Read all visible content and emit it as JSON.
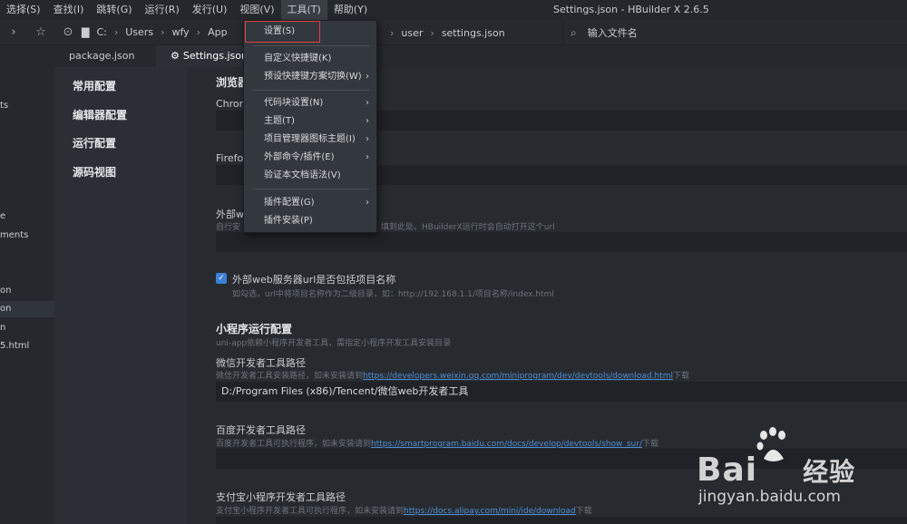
{
  "menubar": {
    "items": [
      "选择(S)",
      "查找(I)",
      "跳转(G)",
      "运行(R)",
      "发行(U)",
      "视图(V)",
      "工具(T)",
      "帮助(Y)"
    ],
    "window_title": "Settings.json - HBuilder X 2.6.5"
  },
  "toolbar": {
    "breadcrumb": [
      "C:",
      "Users",
      "wfy",
      "App"
    ],
    "breadcrumb_tail": [
      "user",
      "settings.json"
    ],
    "search_placeholder": "输入文件名"
  },
  "filebar": {
    "items": [
      "ts",
      "e",
      "ments",
      "on",
      "on",
      "n",
      "5.html"
    ]
  },
  "tabs": [
    {
      "label": "package.json"
    },
    {
      "label": "Settings.json"
    }
  ],
  "settings_nav": [
    "常用配置",
    "编辑器配置",
    "运行配置",
    "源码视图"
  ],
  "content": {
    "browser_heading": "浏览器",
    "chrome_label": "Chrom",
    "firefox_label": "Firefo",
    "external_label": "外部w",
    "external_hint": "自行安",
    "external_hint_tail": "填到此处。HBuilderX运行时会自动打开这个url",
    "checkbox_label": "外部web服务器url是否包括项目名称",
    "checkbox_hint": "如勾选，url中将项目名称作为二级目录，如：http://192.168.1.1/项目名称/index.html",
    "mp_section": "小程序运行配置",
    "mp_hint": "uni-app依赖小程序开发者工具，需指定小程序开发工具安装目录",
    "wechat_label": "微信开发者工具路径",
    "wechat_hint_pre": "微信开发者工具安装路径，如未安装请到",
    "wechat_link": "https://developers.weixin.qq.com/miniprogram/dev/devtools/download.html",
    "wechat_hint_post": "下载",
    "wechat_value": "D:/Program Files (x86)/Tencent/微信web开发者工具",
    "baidu_label": "百度开发者工具路径",
    "baidu_hint_pre": "百度开发者工具可执行程序，如未安装请到",
    "baidu_link": "https://smartprogram.baidu.com/docs/develop/devtools/show_sur/",
    "baidu_hint_post": "下载",
    "alipay_label": "支付宝小程序开发者工具路径",
    "alipay_hint_pre": "支付宝小程序开发者工具可执行程序，如未安装请到",
    "alipay_link": "https://docs.alipay.com/mini/ide/download",
    "alipay_hint_post": "下载"
  },
  "dropdown": {
    "items": [
      {
        "label": "设置(S)",
        "submenu": false
      },
      {
        "label": "自定义快捷键(K)",
        "submenu": false
      },
      {
        "label": "预设快捷键方案切换(W)",
        "submenu": true
      },
      {
        "label": "代码块设置(N)",
        "submenu": true
      },
      {
        "label": "主题(T)",
        "submenu": true
      },
      {
        "label": "项目管理器图标主题(I)",
        "submenu": true
      },
      {
        "label": "外部命令/插件(E)",
        "submenu": true
      },
      {
        "label": "验证本文档语法(V)",
        "submenu": false
      },
      {
        "label": "插件配置(G)",
        "submenu": true
      },
      {
        "label": "插件安装(P)",
        "submenu": false
      }
    ],
    "highlight_color": "#e04040"
  },
  "watermark": {
    "logo": "Bai",
    "logo_tail": "经验",
    "url": "jingyan.baidu.com"
  },
  "colors": {
    "accent": "#3b82d6",
    "link": "#4f8ed6",
    "background": "#272b30"
  }
}
